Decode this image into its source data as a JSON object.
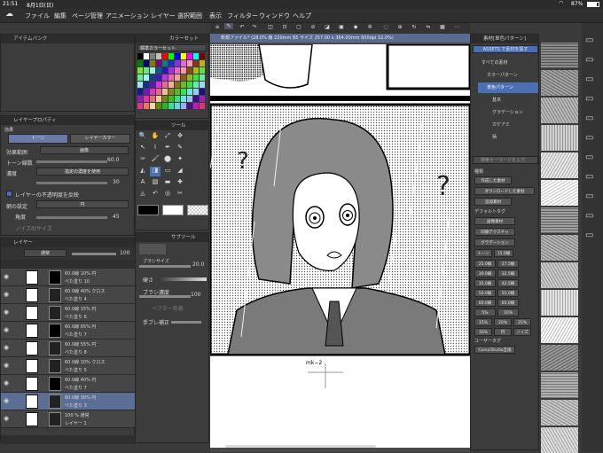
{
  "status": {
    "time": "21:51",
    "date": "8月1日(日)",
    "battery": "87%"
  },
  "menu": [
    "ファイル",
    "編集",
    "ページ管理",
    "アニメーション",
    "レイヤー",
    "選択範囲",
    "表示",
    "フィルター",
    "ウィンドウ",
    "ヘルプ"
  ],
  "panels": {
    "item_bank": "アイテムバンク",
    "color_set": "カラーセット",
    "color_set_select": "標準カラーセット",
    "layer_property": "レイヤープロパティ",
    "tone_btn": "トーン",
    "layer_color_btn": "レイヤーカラー",
    "effect_label": "効果",
    "effect_range": "効果範囲",
    "effect_range_value": "画像",
    "tone_density": "トーン線数",
    "tone_density_value": "60.0",
    "density": "濃度",
    "density_value": "指定の濃度を使用",
    "density_num": "30",
    "transparent_reflect": "レイヤーの不透明度を反映",
    "dot_setting": "網の設定",
    "dot_value": "円",
    "angle": "角度",
    "angle_value": "45",
    "noise_size": "ノイズのサイズ",
    "tool": "ツール",
    "sub_tool": "サブツール",
    "brush_size_label": "ブラシサイズ",
    "brush_size": "20.0",
    "hardness": "硬さ",
    "brush_density": "ブラシ濃度",
    "brush_density_value": "100",
    "vector_snap": "ベクター吸着",
    "hand_shake": "手ブレ補正",
    "layer_tab": "レイヤー",
    "blend_mode": "通常",
    "opacity": "100"
  },
  "canvas_title": "新規ファイル* (28.0% 線 220mm B5 サイズ 257.00 x 364.00mm 600dpi 52.0%)",
  "canvas_label": "mk−2",
  "layers": [
    {
      "line1": "60.0線 10% 円",
      "line2": "べた塗り 10"
    },
    {
      "line1": "60.0線 40% クロス",
      "line2": "べた塗り 4"
    },
    {
      "line1": "60.0線 15% 円",
      "line2": "べた塗り 6"
    },
    {
      "line1": "60.0線 65% 円",
      "line2": "べた塗り 7"
    },
    {
      "line1": "60.0線 55% 円",
      "line2": "べた塗り 8"
    },
    {
      "line1": "60.0線 10% クロス",
      "line2": "べた塗り 5"
    },
    {
      "line1": "60.0線 40% 円",
      "line2": "べた塗り 7"
    },
    {
      "line1": "60.0線 30% 円",
      "line2": "べた塗り 3"
    },
    {
      "line1": "100 % 通常",
      "line2": "レイヤー 1"
    }
  ],
  "assets": {
    "header": "素材[単色パターン]",
    "search_btn": "ASSETS で素材を探す",
    "tree": [
      "すべての素材",
      "カラーパターン",
      "単色パターン",
      "基本",
      "グラデーション",
      "カケアミ",
      "柄"
    ],
    "search_placeholder": "検索キーワードを入力",
    "tag_label": "種類",
    "tags": [
      "作成した素材",
      "ダウンロードした素材",
      "追加素材"
    ],
    "default_tag": "デフォルトタグ",
    "tags2": [
      "画像素材",
      "同線テクスチャ",
      "グラデーション"
    ],
    "tone_row": [
      "トーン",
      "15.0線"
    ],
    "lines": [
      [
        "25.0線",
        "27.5線"
      ],
      [
        "30.0線",
        "32.5線"
      ],
      [
        "35.0線",
        "42.5線"
      ],
      [
        "50.0線",
        "55.0線"
      ],
      [
        "60.0線",
        "65.0線"
      ],
      [
        "5%",
        "10%"
      ],
      [
        "15%",
        "20%",
        "25%"
      ],
      [
        "30%",
        "円",
        "ノイズ"
      ]
    ],
    "user_tag": "ユーザータグ",
    "comic_studio": "ComicStudio互換"
  },
  "colors": {
    "accent": "#4a6fb5",
    "selected_layer": "#5b6f95"
  }
}
